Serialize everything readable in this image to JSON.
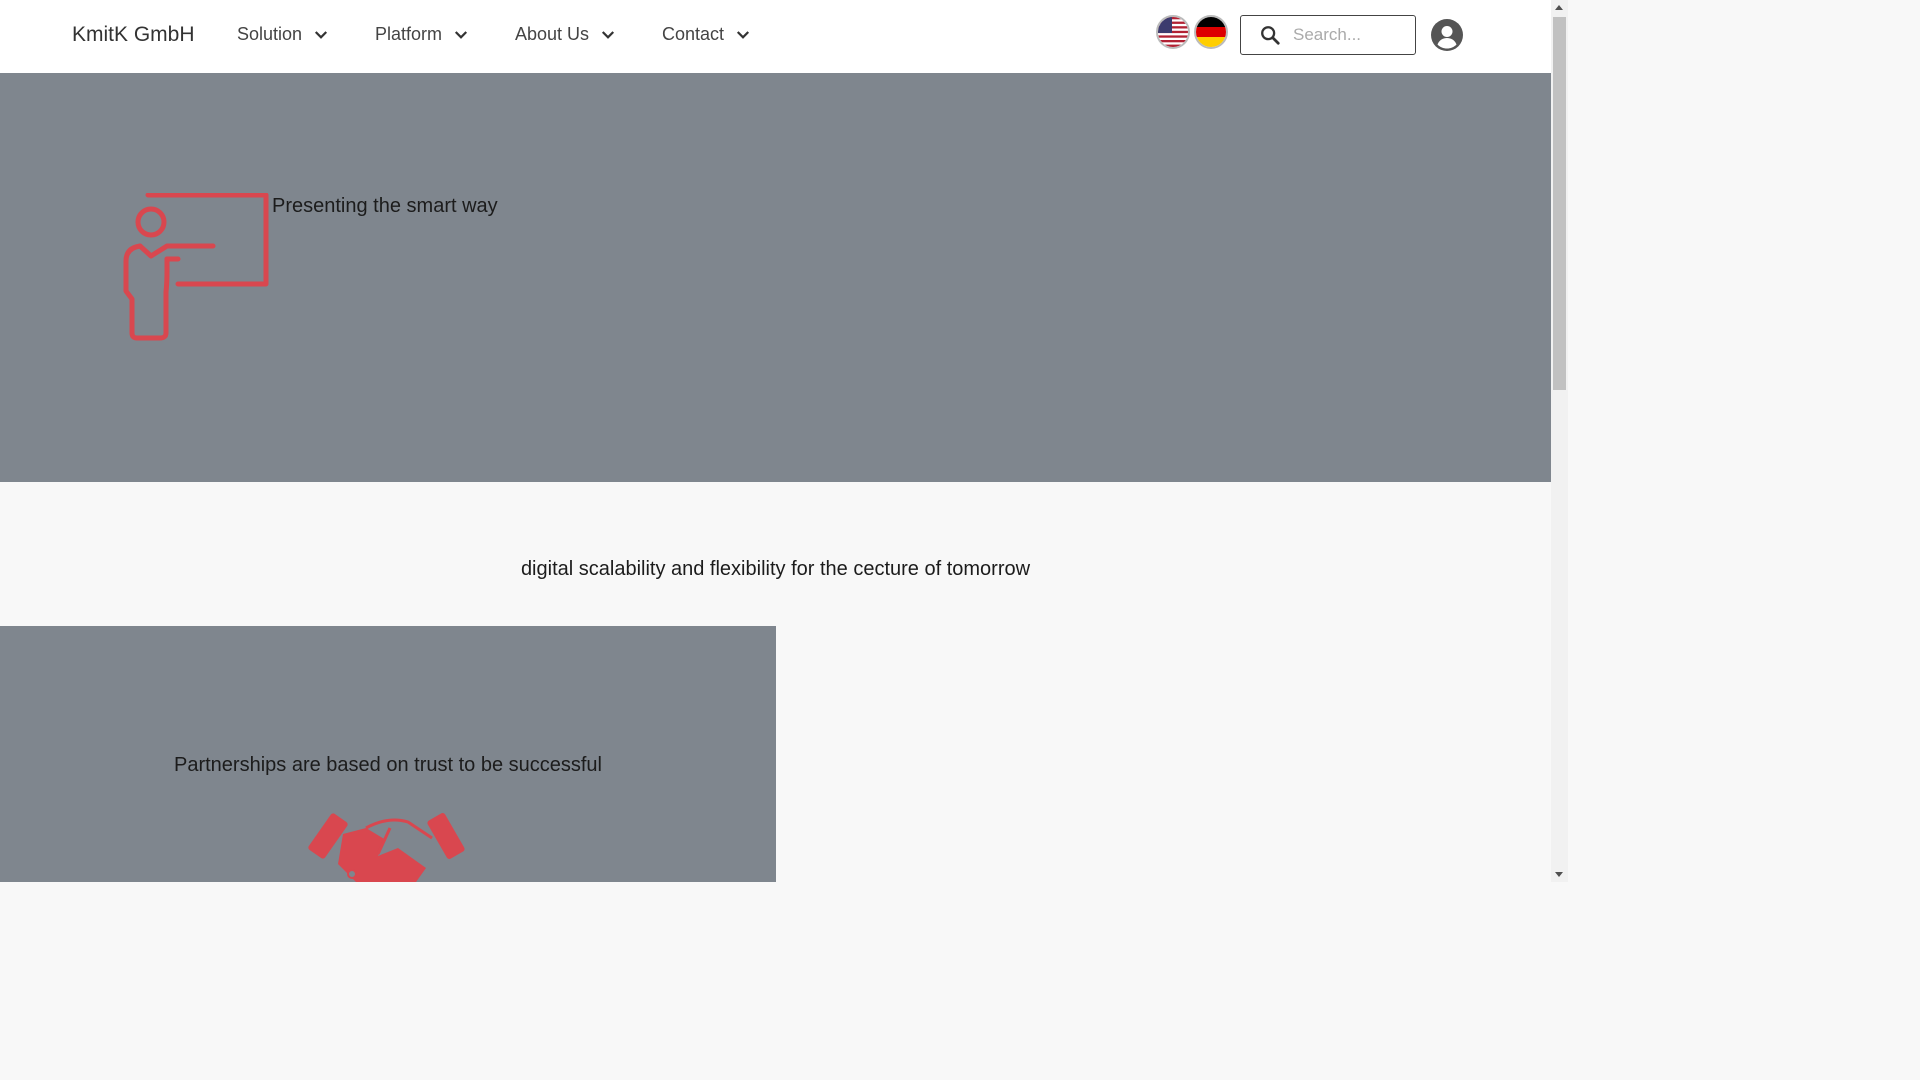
{
  "nav": {
    "brand": "KmitK GmbH",
    "items": [
      {
        "label": "Solution"
      },
      {
        "label": "Platform"
      },
      {
        "label": "About Us"
      },
      {
        "label": "Contact"
      }
    ],
    "search_placeholder": "Search...",
    "languages": [
      "us-flag-icon",
      "de-flag-icon"
    ]
  },
  "hero": {
    "text": "Presenting the smart way",
    "icon": "presenter-board-icon"
  },
  "tagline": "digital scalability and flexibility for the cecture of tomorrow",
  "partnership": {
    "text": "Partnerships are based on trust to be successful",
    "icon": "handshake-icon"
  },
  "colors": {
    "accent": "#d9474f",
    "section_bg": "#7f868e",
    "page_bg": "#f8f8f8"
  }
}
